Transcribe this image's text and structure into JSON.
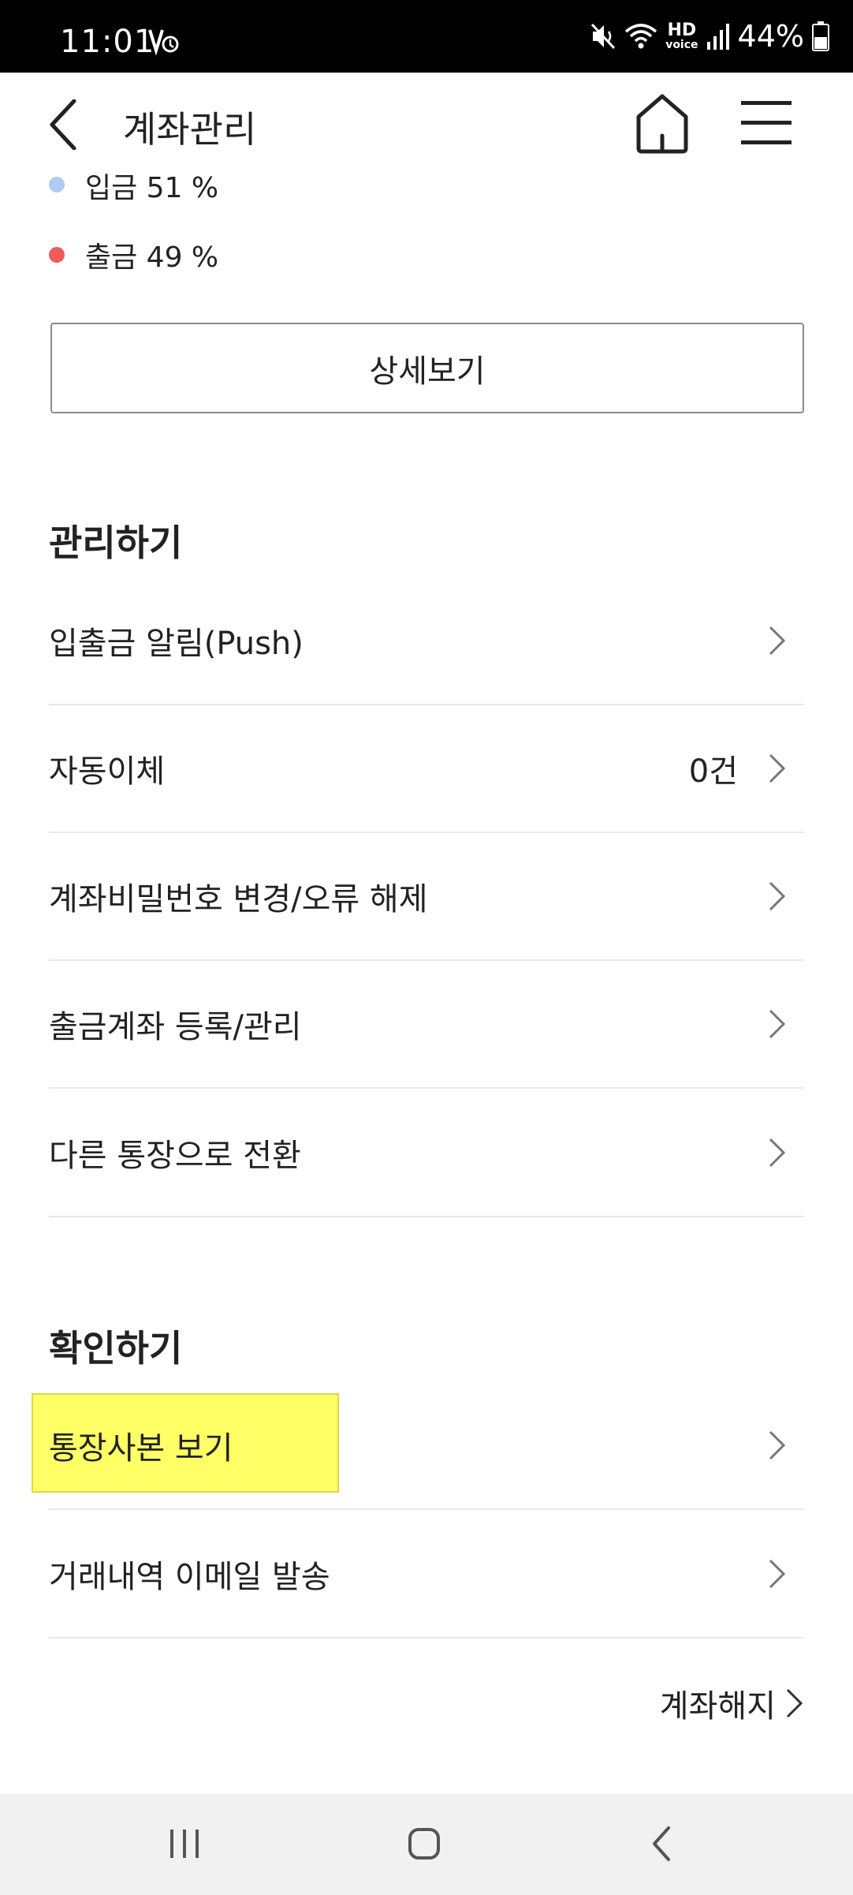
{
  "status_bar": {
    "time": "11:01",
    "battery": "44%",
    "hd_voice_top": "HD",
    "hd_voice_bottom": "voice",
    "icons": [
      "nfc-icon",
      "mute-icon",
      "wifi-icon",
      "hd-voice-icon",
      "signal-icon",
      "battery-icon"
    ]
  },
  "header": {
    "title": "계좌관리",
    "back_icon": "chevron-left-icon",
    "home_icon": "home-icon",
    "menu_icon": "hamburger-menu-icon"
  },
  "chart_legend": {
    "items": [
      {
        "label": "입금 51 %",
        "color": "#aecbf0"
      },
      {
        "label": "출금 49 %",
        "color": "#f05a5a"
      }
    ]
  },
  "detail_button": {
    "label": "상세보기"
  },
  "manage_section": {
    "title": "관리하기",
    "items": [
      {
        "label": "입출금 알림(Push)",
        "value": ""
      },
      {
        "label": "자동이체",
        "value": "0건"
      },
      {
        "label": "계좌비밀번호 변경/오류 해제",
        "value": ""
      },
      {
        "label": "출금계좌 등록/관리",
        "value": ""
      },
      {
        "label": "다른 통장으로 전환",
        "value": ""
      }
    ]
  },
  "check_section": {
    "title": "확인하기",
    "items": [
      {
        "label": "통장사본 보기",
        "value": "",
        "highlighted": true
      },
      {
        "label": "거래내역 이메일 발송",
        "value": ""
      }
    ]
  },
  "footer_link": {
    "label": "계좌해지"
  },
  "nav_bar": {
    "icons": [
      "recent-apps-icon",
      "home-button-icon",
      "back-icon"
    ]
  },
  "colors": {
    "highlight": "#ffff66",
    "divider": "#e8e8e8",
    "deposit": "#aecbf0",
    "withdrawal": "#f05a5a"
  }
}
